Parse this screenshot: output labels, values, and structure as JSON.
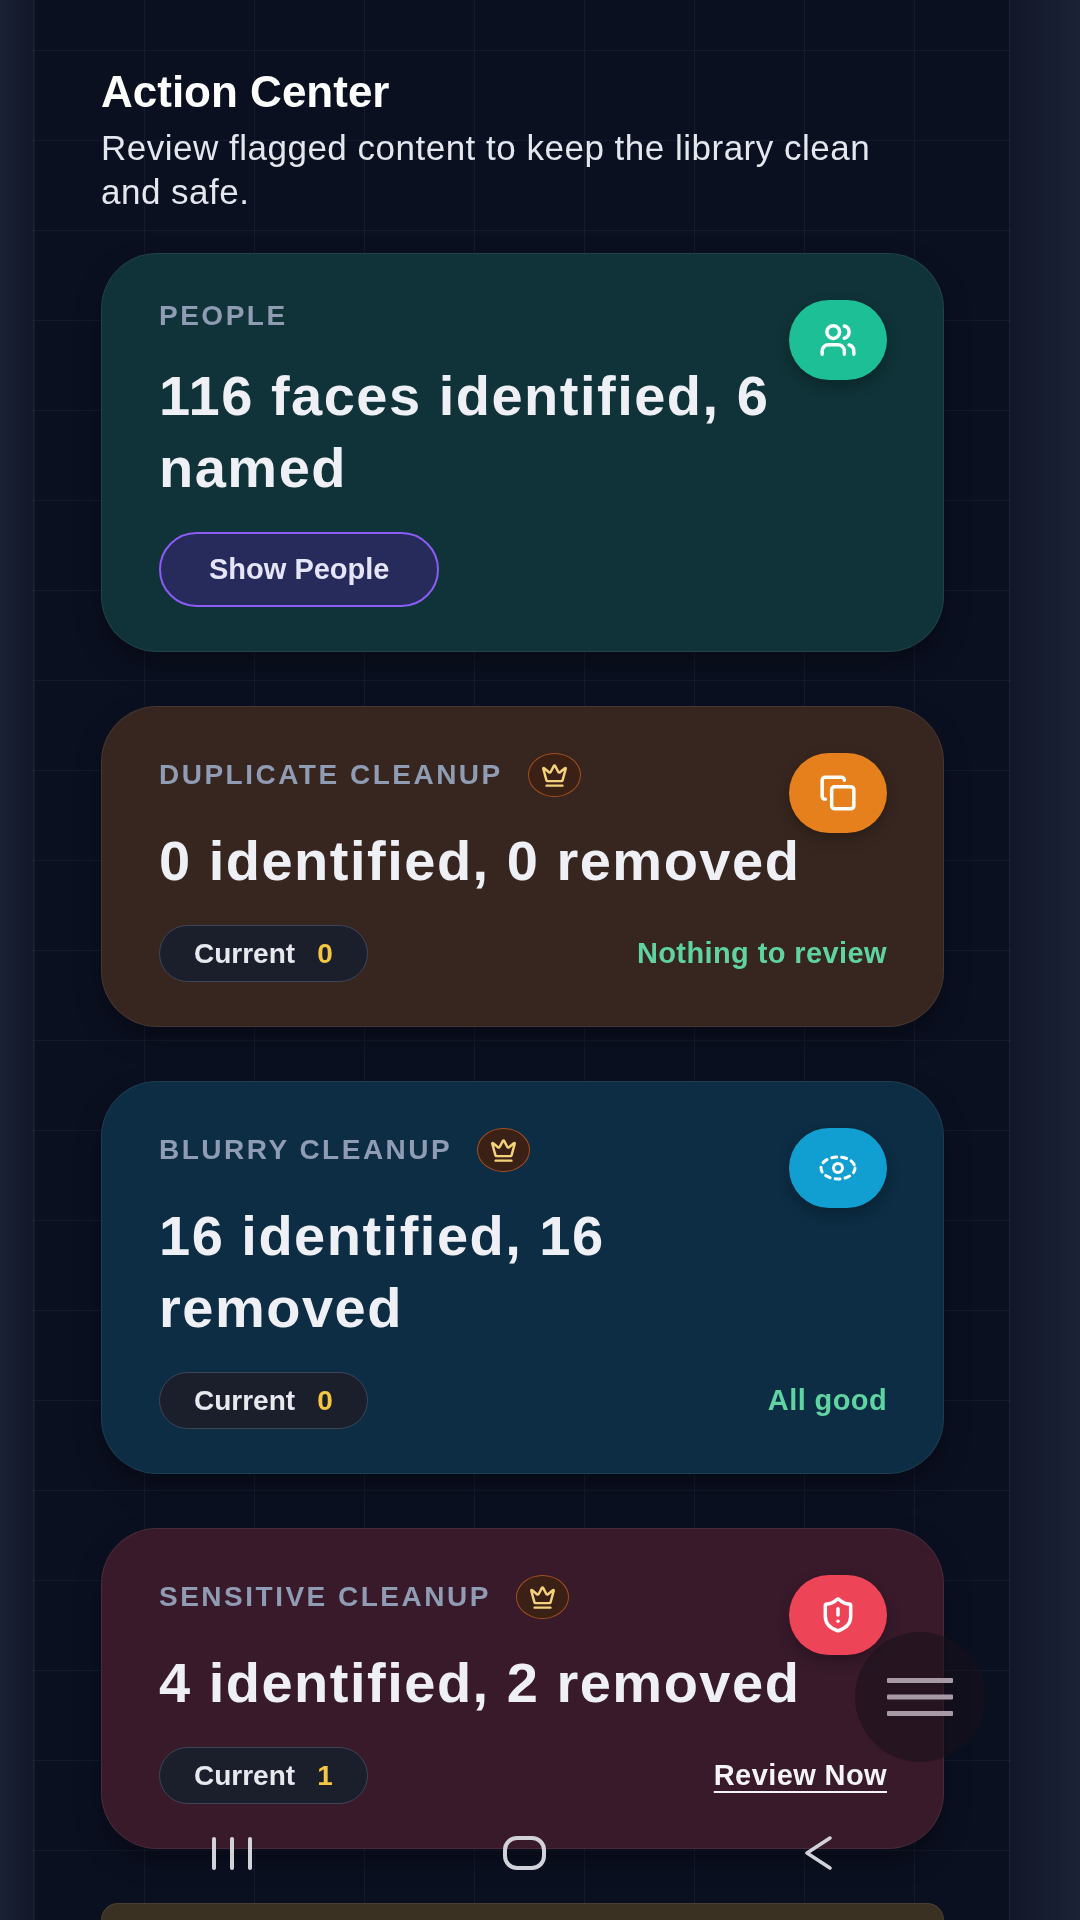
{
  "header": {
    "title": "Action Center",
    "subtitle": "Review flagged content to keep the library clean and safe."
  },
  "cards": [
    {
      "kind": "people",
      "label": "PEOPLE",
      "premium": false,
      "color": "#1dbf97",
      "title": "116 faces identified, 6 named",
      "action": {
        "label": "Show People"
      }
    },
    {
      "kind": "duplicates",
      "label": "DUPLICATE CLEANUP",
      "premium": true,
      "color": "#e5801c",
      "title": "0 identified, 0 removed",
      "current": {
        "label": "Current",
        "value": "0"
      },
      "status": {
        "kind": "ok",
        "text": "Nothing to review"
      }
    },
    {
      "kind": "blurry",
      "label": "BLURRY CLEANUP",
      "premium": true,
      "color": "#119fd2",
      "title": "16 identified, 16 removed",
      "current": {
        "label": "Current",
        "value": "0"
      },
      "status": {
        "kind": "ok",
        "text": "All good"
      }
    },
    {
      "kind": "sensitive",
      "label": "SENSITIVE CLEANUP",
      "premium": true,
      "color": "#ee4458",
      "title": "4 identified, 2 removed",
      "current": {
        "label": "Current",
        "value": "1"
      },
      "status": {
        "kind": "link",
        "text": "Review Now"
      }
    }
  ]
}
